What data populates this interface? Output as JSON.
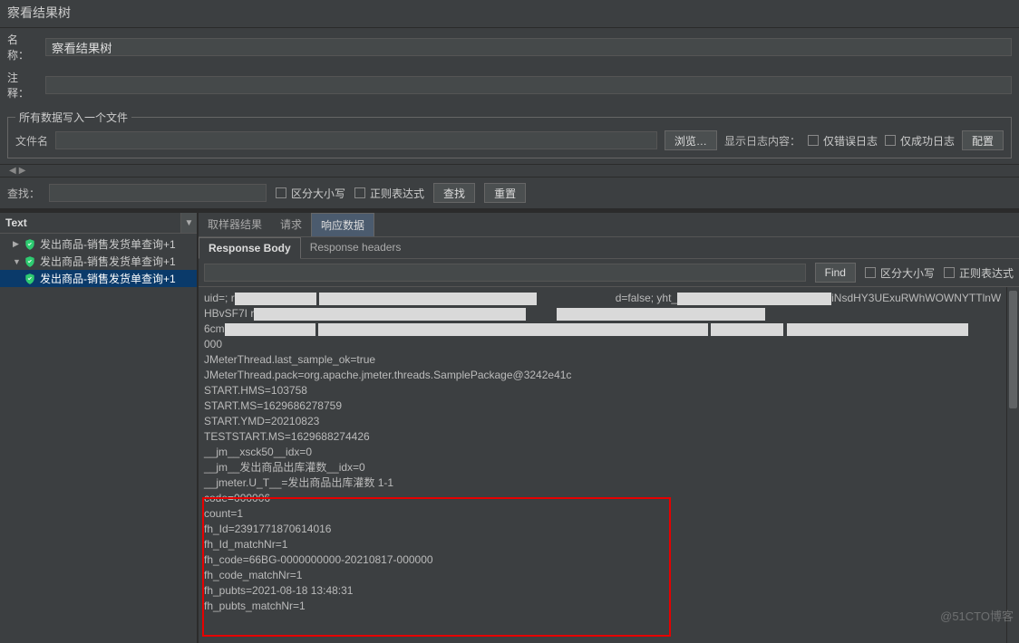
{
  "title": "察看结果树",
  "fields": {
    "name_label": "名称：",
    "name_value": "察看结果树",
    "comment_label": "注释："
  },
  "file_section": {
    "legend": "所有数据写入一个文件",
    "filename_label": "文件名",
    "browse": "浏览…",
    "show_log_label": "显示日志内容：",
    "only_error": "仅错误日志",
    "only_success": "仅成功日志",
    "config": "配置"
  },
  "search": {
    "label": "查找：",
    "case": "区分大小写",
    "regex": "正则表达式",
    "find_btn": "查找",
    "reset_btn": "重置"
  },
  "tree": {
    "selector": "Text",
    "items": [
      {
        "label": "发出商品-销售发货单查询+1",
        "level": 1,
        "expand": "▶"
      },
      {
        "label": "发出商品-销售发货单查询+1",
        "level": 1,
        "expand": "▼"
      },
      {
        "label": "发出商品-销售发货单查询+1",
        "level": 2,
        "selected": true
      }
    ]
  },
  "detail_tabs": {
    "sampler": "取样器结果",
    "request": "请求",
    "response": "响应数据"
  },
  "sub_tabs": {
    "body": "Response Body",
    "headers": "Response headers"
  },
  "find_bar": {
    "btn": "Find",
    "case": "区分大小写",
    "regex": "正则表达式"
  },
  "response_lines": {
    "l0a": "uid=; r",
    "l0b": "d=false; yht_",
    "l0c": "iNsdHY3UExuRWhWOWNYTTlnW",
    "l1a": "HBvSF7I r",
    "l2a": "6cm",
    "l3": "000",
    "l4": "JMeterThread.last_sample_ok=true",
    "l5": "JMeterThread.pack=org.apache.jmeter.threads.SamplePackage@3242e41c",
    "l6": "START.HMS=103758",
    "l7": "START.MS=1629686278759",
    "l8": "START.YMD=20210823",
    "l9": "TESTSTART.MS=1629688274426",
    "l10": "__jm__xsck50__idx=0",
    "l11": "__jm__发出商品出库灌数__idx=0",
    "l12": "__jmeter.U_T__=发出商品出库灌数 1-1",
    "l13": "code=000006",
    "l14": "count=1",
    "l15": "fh_Id=2391771870614016",
    "l16": "fh_Id_matchNr=1",
    "l17": "fh_code=66BG-0000000000-20210817-000000",
    "l18": "fh_code_matchNr=1",
    "l19": "fh_pubts=2021-08-18 13:48:31",
    "l20": "fh_pubts_matchNr=1"
  },
  "watermark": "@51CTO博客"
}
